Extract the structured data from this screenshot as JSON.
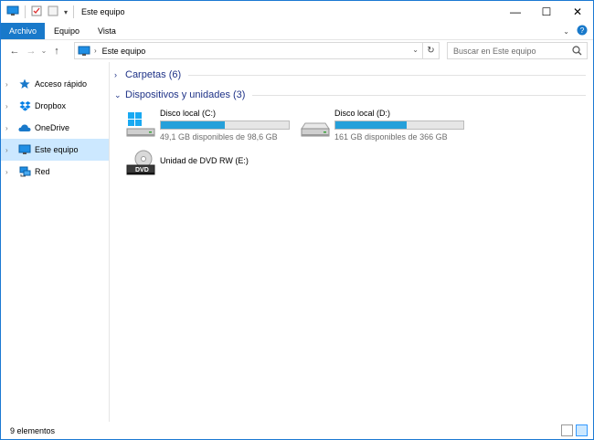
{
  "window": {
    "title": "Este equipo",
    "controls": {
      "minimize": "—",
      "maximize": "☐",
      "close": "✕"
    }
  },
  "ribbon": {
    "tabs": [
      {
        "label": "Archivo",
        "active": true
      },
      {
        "label": "Equipo",
        "active": false
      },
      {
        "label": "Vista",
        "active": false
      }
    ]
  },
  "navigation": {
    "address": {
      "crumbs": [
        "Este equipo"
      ],
      "icon": "computer-icon"
    },
    "search": {
      "placeholder": "Buscar en Este equipo"
    }
  },
  "sidebar": {
    "items": [
      {
        "label": "Acceso rápido",
        "icon": "star-icon",
        "selected": false
      },
      {
        "label": "Dropbox",
        "icon": "dropbox-icon",
        "selected": false
      },
      {
        "label": "OneDrive",
        "icon": "cloud-icon",
        "selected": false
      },
      {
        "label": "Este equipo",
        "icon": "computer-icon",
        "selected": true
      },
      {
        "label": "Red",
        "icon": "network-icon",
        "selected": false
      }
    ]
  },
  "content": {
    "groups": [
      {
        "title": "Carpetas (6)",
        "expanded": false
      },
      {
        "title": "Dispositivos y unidades (3)",
        "expanded": true
      }
    ],
    "drives": [
      {
        "name": "Disco local (C:)",
        "free": "49,1 GB disponibles de 98,6 GB",
        "used_fraction": 0.5,
        "icon": "windows-drive-icon"
      },
      {
        "name": "Disco local (D:)",
        "free": "161 GB disponibles de 366 GB",
        "used_fraction": 0.56,
        "icon": "hard-drive-icon"
      },
      {
        "name": "Unidad de DVD RW (E:)",
        "free": "",
        "icon": "dvd-drive-icon"
      }
    ]
  },
  "status": {
    "count": "9 elementos"
  },
  "colors": {
    "accent": "#1979ca",
    "selection": "#cce8ff",
    "bar_fill": "#26a0da",
    "group_title": "#1e3287"
  }
}
